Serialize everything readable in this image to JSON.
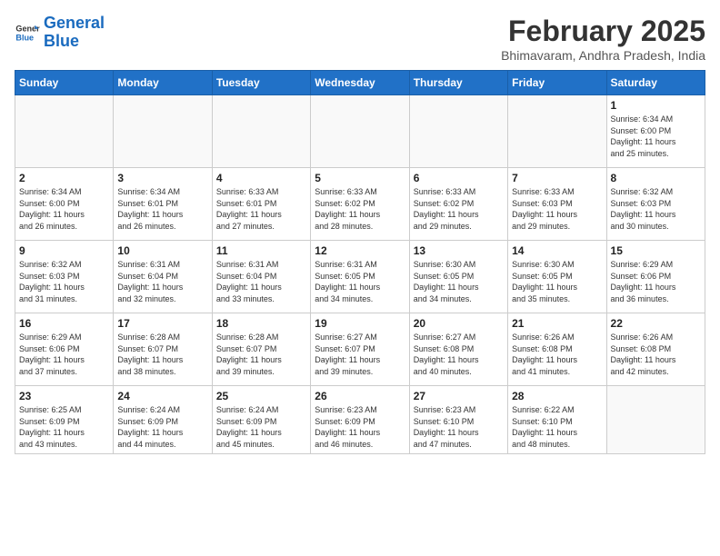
{
  "header": {
    "logo_general": "General",
    "logo_blue": "Blue",
    "month_year": "February 2025",
    "location": "Bhimavaram, Andhra Pradesh, India"
  },
  "days_of_week": [
    "Sunday",
    "Monday",
    "Tuesday",
    "Wednesday",
    "Thursday",
    "Friday",
    "Saturday"
  ],
  "weeks": [
    [
      {
        "day": "",
        "info": ""
      },
      {
        "day": "",
        "info": ""
      },
      {
        "day": "",
        "info": ""
      },
      {
        "day": "",
        "info": ""
      },
      {
        "day": "",
        "info": ""
      },
      {
        "day": "",
        "info": ""
      },
      {
        "day": "1",
        "info": "Sunrise: 6:34 AM\nSunset: 6:00 PM\nDaylight: 11 hours\nand 25 minutes."
      }
    ],
    [
      {
        "day": "2",
        "info": "Sunrise: 6:34 AM\nSunset: 6:00 PM\nDaylight: 11 hours\nand 26 minutes."
      },
      {
        "day": "3",
        "info": "Sunrise: 6:34 AM\nSunset: 6:01 PM\nDaylight: 11 hours\nand 26 minutes."
      },
      {
        "day": "4",
        "info": "Sunrise: 6:33 AM\nSunset: 6:01 PM\nDaylight: 11 hours\nand 27 minutes."
      },
      {
        "day": "5",
        "info": "Sunrise: 6:33 AM\nSunset: 6:02 PM\nDaylight: 11 hours\nand 28 minutes."
      },
      {
        "day": "6",
        "info": "Sunrise: 6:33 AM\nSunset: 6:02 PM\nDaylight: 11 hours\nand 29 minutes."
      },
      {
        "day": "7",
        "info": "Sunrise: 6:33 AM\nSunset: 6:03 PM\nDaylight: 11 hours\nand 29 minutes."
      },
      {
        "day": "8",
        "info": "Sunrise: 6:32 AM\nSunset: 6:03 PM\nDaylight: 11 hours\nand 30 minutes."
      }
    ],
    [
      {
        "day": "9",
        "info": "Sunrise: 6:32 AM\nSunset: 6:03 PM\nDaylight: 11 hours\nand 31 minutes."
      },
      {
        "day": "10",
        "info": "Sunrise: 6:31 AM\nSunset: 6:04 PM\nDaylight: 11 hours\nand 32 minutes."
      },
      {
        "day": "11",
        "info": "Sunrise: 6:31 AM\nSunset: 6:04 PM\nDaylight: 11 hours\nand 33 minutes."
      },
      {
        "day": "12",
        "info": "Sunrise: 6:31 AM\nSunset: 6:05 PM\nDaylight: 11 hours\nand 34 minutes."
      },
      {
        "day": "13",
        "info": "Sunrise: 6:30 AM\nSunset: 6:05 PM\nDaylight: 11 hours\nand 34 minutes."
      },
      {
        "day": "14",
        "info": "Sunrise: 6:30 AM\nSunset: 6:05 PM\nDaylight: 11 hours\nand 35 minutes."
      },
      {
        "day": "15",
        "info": "Sunrise: 6:29 AM\nSunset: 6:06 PM\nDaylight: 11 hours\nand 36 minutes."
      }
    ],
    [
      {
        "day": "16",
        "info": "Sunrise: 6:29 AM\nSunset: 6:06 PM\nDaylight: 11 hours\nand 37 minutes."
      },
      {
        "day": "17",
        "info": "Sunrise: 6:28 AM\nSunset: 6:07 PM\nDaylight: 11 hours\nand 38 minutes."
      },
      {
        "day": "18",
        "info": "Sunrise: 6:28 AM\nSunset: 6:07 PM\nDaylight: 11 hours\nand 39 minutes."
      },
      {
        "day": "19",
        "info": "Sunrise: 6:27 AM\nSunset: 6:07 PM\nDaylight: 11 hours\nand 39 minutes."
      },
      {
        "day": "20",
        "info": "Sunrise: 6:27 AM\nSunset: 6:08 PM\nDaylight: 11 hours\nand 40 minutes."
      },
      {
        "day": "21",
        "info": "Sunrise: 6:26 AM\nSunset: 6:08 PM\nDaylight: 11 hours\nand 41 minutes."
      },
      {
        "day": "22",
        "info": "Sunrise: 6:26 AM\nSunset: 6:08 PM\nDaylight: 11 hours\nand 42 minutes."
      }
    ],
    [
      {
        "day": "23",
        "info": "Sunrise: 6:25 AM\nSunset: 6:09 PM\nDaylight: 11 hours\nand 43 minutes."
      },
      {
        "day": "24",
        "info": "Sunrise: 6:24 AM\nSunset: 6:09 PM\nDaylight: 11 hours\nand 44 minutes."
      },
      {
        "day": "25",
        "info": "Sunrise: 6:24 AM\nSunset: 6:09 PM\nDaylight: 11 hours\nand 45 minutes."
      },
      {
        "day": "26",
        "info": "Sunrise: 6:23 AM\nSunset: 6:09 PM\nDaylight: 11 hours\nand 46 minutes."
      },
      {
        "day": "27",
        "info": "Sunrise: 6:23 AM\nSunset: 6:10 PM\nDaylight: 11 hours\nand 47 minutes."
      },
      {
        "day": "28",
        "info": "Sunrise: 6:22 AM\nSunset: 6:10 PM\nDaylight: 11 hours\nand 48 minutes."
      },
      {
        "day": "",
        "info": ""
      }
    ]
  ]
}
